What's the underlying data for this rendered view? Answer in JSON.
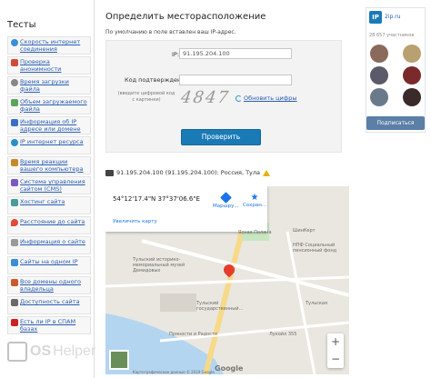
{
  "sidebar": {
    "title": "Тесты",
    "items": [
      {
        "label": "Скорость интернет соединения",
        "icon": "globe-icon"
      },
      {
        "label": "Проверка анонимности",
        "icon": "chart-icon"
      },
      {
        "label": "Время загрузки файла",
        "icon": "clock-icon"
      },
      {
        "label": "Объем загружаемого файла",
        "icon": "box-icon"
      },
      {
        "label": "Информация об IP адресе или домене",
        "icon": "info-icon"
      },
      {
        "label": "IP интернет ресурса",
        "icon": "globe-icon"
      },
      {
        "label": "Время реакции вашего компьютера",
        "icon": "ping-icon"
      },
      {
        "label": "Система управления сайтом (CMS)",
        "icon": "cms-icon"
      },
      {
        "label": "Хостинг сайта",
        "icon": "host-icon"
      },
      {
        "label": "Расстояние до сайта",
        "icon": "pin-icon"
      },
      {
        "label": "Информация о сайте",
        "icon": "doc-icon"
      },
      {
        "label": "Сайты на одном IP",
        "icon": "sites-icon"
      },
      {
        "label": "Все домены одного владельца",
        "icon": "domain-icon"
      },
      {
        "label": "Доступность сайта",
        "icon": "access-icon"
      },
      {
        "label": "Есть ли IP в СПАМ базах",
        "icon": "spam-icon"
      }
    ]
  },
  "main": {
    "title": "Определить месторасположение",
    "subtitle": "По умолчанию в поле вставлен ваш IP-адрес.",
    "ip_label": "IP:",
    "ip_value": "91.195.204.100",
    "code_label": "Код подтверждения:",
    "code_hint": "(введите цифровой код с картинки)",
    "captcha_text": "4847",
    "refresh_label": "Обновить цифры",
    "submit_label": "Проверить",
    "result_text": "91.195.204.100 (91.195.204.100): Россия, Тула"
  },
  "map": {
    "coords": "54°12'17.4\"N 37°37'06.6\"E",
    "route_label": "Маршру...",
    "save_label": "Сохран...",
    "bigger_label": "Увеличить карту",
    "labels": {
      "l1": "Ясная Поляна",
      "l2": "ШинКерт",
      "l3": "НПФ Социальный пенсионный фонд",
      "l4": "Тульский историко-мемориальный музей Демидовых",
      "l5": "Тульский государственный...",
      "l6": "Пряности и Радости",
      "l7": "Лукойл 355",
      "l8": "Тульская",
      "l9": "Google",
      "l10": "Картографические данные © 2019 Google"
    },
    "zoom_in": "+",
    "zoom_out": "−"
  },
  "widget": {
    "logo": "IP",
    "name": "2ip.ru",
    "count": "28 657 участников",
    "subscribe_label": "Подписаться"
  },
  "watermark": {
    "brand": "OS",
    "brand2": "Helper"
  }
}
